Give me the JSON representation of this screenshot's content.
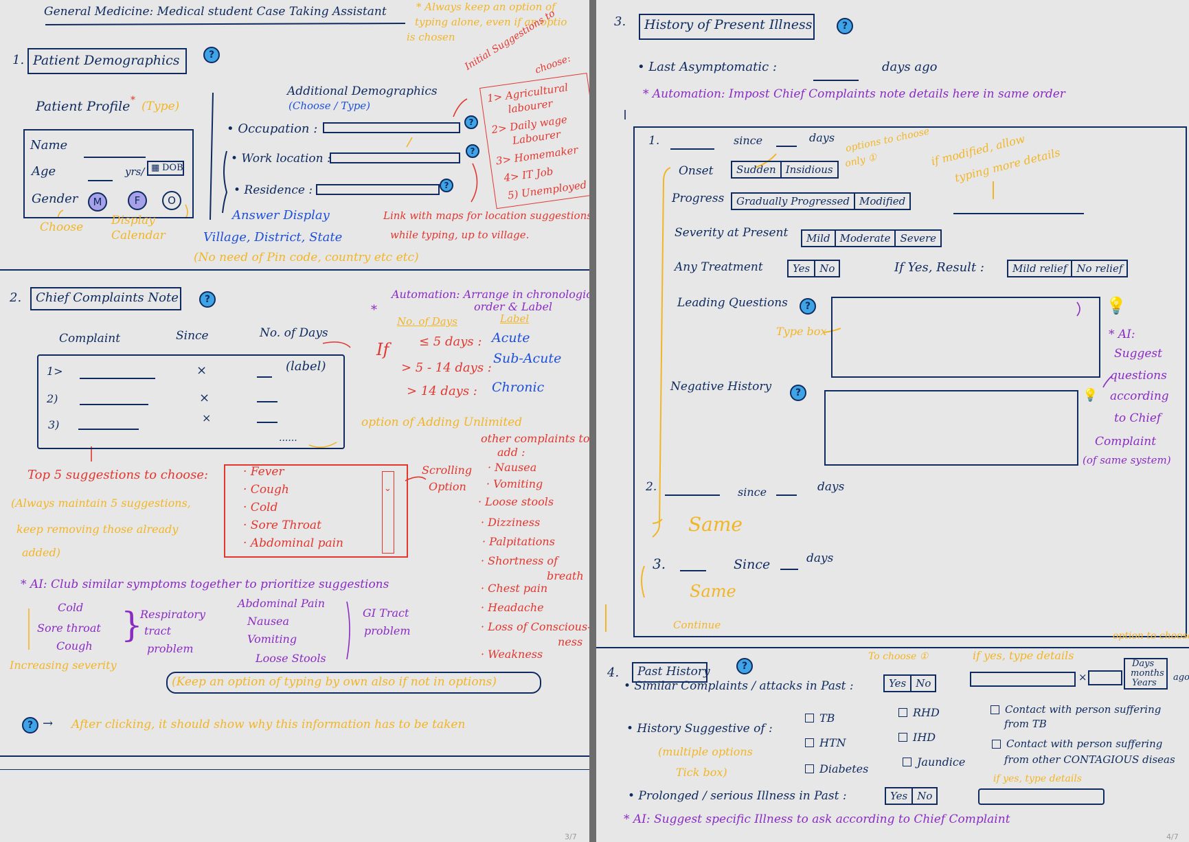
{
  "pages": {
    "left": {
      "page_number": "3/7",
      "doc_title": "General Medicine: Medical student Case Taking Assistant",
      "top_note": [
        "* Always keep an option of",
        "typing alone, even if an optio",
        "is chosen"
      ],
      "help_glyph": "?",
      "demographics": {
        "heading_num": "1.",
        "heading": "Patient Demographics",
        "profile_title": "Patient Profile",
        "asterisk": "*",
        "profile_type_note": "(Type)",
        "name_label": "Name",
        "age_label": "Age",
        "age_unit": "yrs/",
        "dob_label": "DOB",
        "gender_label": "Gender",
        "gender_options": [
          "M",
          "F",
          "O"
        ],
        "choose_note": "Choose",
        "display_note": [
          "Display",
          "Calendar"
        ],
        "additional_title": "Additional Demographics",
        "additional_note": "(Choose / Type)",
        "fields": [
          "• Occupation :",
          "• Work location :",
          "• Residence :"
        ],
        "answer_display": "Answer Display",
        "answer_values": "Village, District, State",
        "answer_note": "(No need of Pin code, country etc etc)",
        "suggestions_title": [
          "Initial Suggestions to",
          "choose:"
        ],
        "occupation_suggestions": [
          "1> Agricultural",
          "labourer",
          "2> Daily wage",
          "Labourer",
          "3> Homemaker",
          "4> IT Job",
          "5) Unemployed"
        ],
        "maps_note": [
          "Link with maps for location suggestions",
          "while typing, up to village."
        ]
      },
      "chief_complaints": {
        "heading_num": "2.",
        "heading": "Chief Complaints Note",
        "columns": [
          "Complaint",
          "Since",
          "No. of Days"
        ],
        "rows": [
          {
            "num": "1>",
            "since": "×",
            "label": "(label)"
          },
          {
            "num": "2)",
            "since": "×",
            "label": ""
          },
          {
            "num": "3)",
            "since": "×",
            "label": ""
          }
        ],
        "more": "......",
        "automation_note": [
          "Automation: Arrange in chronological",
          "order & Label"
        ],
        "auto_star": "*",
        "auto_cols": [
          "No. of Days",
          "Label"
        ],
        "if_word": "If",
        "rules": [
          {
            "cond": "≤ 5 days :",
            "label": "Acute"
          },
          {
            "cond": "> 5 - 14 days :",
            "label": "Sub-Acute"
          },
          {
            "cond": "> 14 days :",
            "label": "Chronic"
          }
        ],
        "unlimited_note": "option of Adding Unlimited",
        "top5_title": "Top 5 suggestions to choose:",
        "top5_note": [
          "(Always maintain 5 suggestions,",
          "keep removing those already",
          "added)"
        ],
        "top5": [
          "· Fever",
          "· Cough",
          "· Cold",
          "· Sore Throat",
          "· Abdominal pain"
        ],
        "scrolling_note": [
          "Scrolling",
          "Option"
        ],
        "other_title": [
          "other complaints to",
          "add :"
        ],
        "other_complaints": [
          "· Nausea",
          "· Vomiting",
          "· Loose stools",
          "· Dizziness",
          "· Palpitations",
          "· Shortness of",
          "breath",
          "· Chest pain",
          "· Headache",
          "· Loss of Conscious-",
          "ness",
          "· Weakness"
        ],
        "ai_note": "* AI: Club similar symptoms together to prioritize suggestions",
        "group1": [
          "Cold",
          "Sore throat",
          "Cough"
        ],
        "group1_label": [
          "Respiratory",
          "tract",
          "problem"
        ],
        "severity_note": "Increasing severity",
        "group2": [
          "Abdominal Pain",
          "Nausea",
          "Vomiting",
          "Loose Stools"
        ],
        "group2_label": [
          "GI Tract",
          "problem"
        ],
        "typing_note": "(Keep an option of typing by own also if not in options)",
        "help_note": "After clicking, it should show why this information has to be taken"
      }
    },
    "right": {
      "page_number": "4/7",
      "hpi": {
        "heading_num": "3.",
        "heading": "History of Present Illness",
        "last_asymptomatic": "• Last Asymptomatic :",
        "days_ago": "days ago",
        "automation": "* Automation: Impost Chief Complaints note details here in same order",
        "item_nums": [
          "1.",
          "2.",
          "3."
        ],
        "since": "since",
        "since_cap": "Since",
        "days": "days",
        "onset_label": "Onset",
        "onset_options": [
          "Sudden",
          "Insidious"
        ],
        "onset_note": [
          "options to choose",
          "only ①"
        ],
        "progress_label": "Progress",
        "progress_options": [
          "Gradually Progressed",
          "Modified"
        ],
        "modified_note": [
          "if modified, allow",
          "typing more details"
        ],
        "severity_label": "Severity at Present",
        "severity_options": [
          "Mild",
          "Moderate",
          "Severe"
        ],
        "treatment_label": "Any Treatment",
        "treatment_options": [
          "Yes",
          "No"
        ],
        "result_label": "If Yes, Result :",
        "result_options": [
          "Mild relief",
          "No relief"
        ],
        "leading_label": "Leading Questions",
        "typebox_note": "Type box",
        "negative_label": "Negative History",
        "ai_note": [
          "* AI:",
          "Suggest",
          "questions",
          "according",
          "to Chief",
          "Complaint",
          "(of same system)"
        ],
        "same": "Same",
        "continue": "Continue"
      },
      "past_history": {
        "heading_num": "4.",
        "heading": "Past History",
        "choose_note": "To choose ①",
        "if_yes_note": "if yes, type details",
        "option_note": "option to choose",
        "similar_label": "• Similar Complaints / attacks in Past :",
        "yes_no": [
          "Yes",
          "No"
        ],
        "times": "×",
        "duration_options": [
          "Days",
          "months",
          "Years"
        ],
        "ago": "ago",
        "suggestive_label": "• History Suggestive of :",
        "multiple_note": [
          "(multiple options",
          "Tick box)"
        ],
        "conditions": [
          "TB",
          "HTN",
          "Diabetes",
          "RHD",
          "IHD",
          "Jaundice"
        ],
        "contacts": [
          "Contact with person suffering",
          "from TB",
          "Contact with person suffering",
          "from other CONTAGIOUS diseas"
        ],
        "prolonged_label": "• Prolonged / serious Illness in Past :",
        "prolonged_note": "if yes, type details",
        "ai_note": "* AI: Suggest specific Illness to ask according to Chief Complaint"
      }
    }
  },
  "colors": {
    "ink": "#0e2a5e",
    "blue": "#1d4fd8",
    "red": "#e2362f",
    "orange": "#f2b526",
    "purple": "#8a2bc4",
    "help_blue": "#3fa4e6",
    "gender_purple": "#a6a1e8"
  }
}
